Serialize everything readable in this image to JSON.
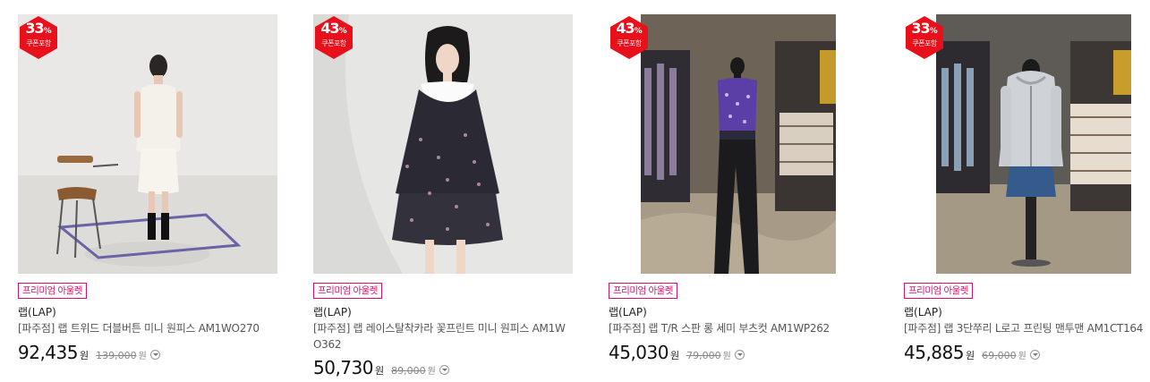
{
  "products": [
    {
      "discount_percent": "33",
      "percent_sign": "%",
      "coupon_label": "쿠폰포함",
      "tag": "프리미엄 아울렛",
      "brand": "랩(LAP)",
      "title": "[파주점] 랩 트위드 더블버튼 미니 원피스 AM1WO270",
      "price": "92,435",
      "currency": "원",
      "original_price": "139,000",
      "original_currency": "원",
      "image": "model-white-tweed-dress-with-chair"
    },
    {
      "discount_percent": "43",
      "percent_sign": "%",
      "coupon_label": "쿠폰포함",
      "tag": "프리미엄 아울렛",
      "brand": "랩(LAP)",
      "title": "[파주점] 랩 레이스탈착카라 꽃프린트 미니 원피스 AM1WO362",
      "price": "50,730",
      "currency": "원",
      "original_price": "89,000",
      "original_currency": "원",
      "image": "model-floral-dress-lace-collar"
    },
    {
      "discount_percent": "43",
      "percent_sign": "%",
      "coupon_label": "쿠폰포함",
      "tag": "프리미엄 아울렛",
      "brand": "랩(LAP)",
      "title": "[파주점] 랩 T/R 스판 롱 세미 부츠컷 AM1WP262",
      "price": "45,030",
      "currency": "원",
      "original_price": "79,000",
      "original_currency": "원",
      "image": "mannequin-purple-vest-black-pants"
    },
    {
      "discount_percent": "33",
      "percent_sign": "%",
      "coupon_label": "쿠폰포함",
      "tag": "프리미엄 아울렛",
      "brand": "랩(LAP)",
      "title": "[파주점] 랩 3단쭈리 L로고 프린팅 맨투맨 AM1CT164",
      "price": "45,885",
      "currency": "원",
      "original_price": "69,000",
      "original_currency": "원",
      "image": "mannequin-grey-hoodie-denim-skirt"
    }
  ],
  "colors": {
    "badge_red": "#e8101a",
    "tag_pink": "#d8106e"
  },
  "icons": {
    "badge": "hexagon-badge-icon",
    "price_info": "chevron-circle-icon"
  }
}
